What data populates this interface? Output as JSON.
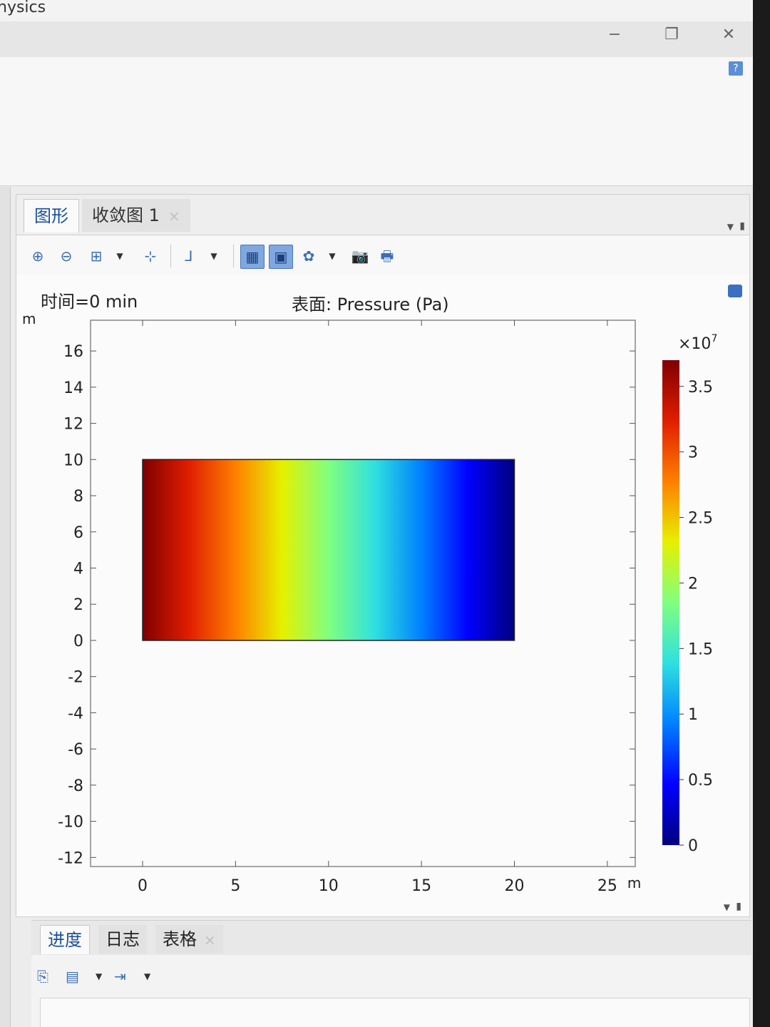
{
  "window": {
    "title": "hysics",
    "minimize": "−",
    "restore": "❐",
    "close": "✕",
    "help": "?"
  },
  "graphics_panel": {
    "tabs": [
      {
        "label": "图形",
        "active": true
      },
      {
        "label": "收敛图 1",
        "close": "×"
      }
    ],
    "panel_menu": "▼",
    "pin": "▮",
    "toolbar": {
      "zoom_in": "⊕",
      "zoom_out": "⊖",
      "zoom_box": "⊞",
      "dropdown": "▼",
      "zoom_extents": "⊹",
      "axis_orientation": "⅃",
      "grid_toggle": "▦",
      "legend_toggle": "▣",
      "scene_light": "✿",
      "snapshot": "📷",
      "print": "🖶"
    },
    "time_label": "时间=0 min",
    "plot_title": "表面: Pressure (Pa)",
    "y_unit": "m",
    "x_unit": "m"
  },
  "chart_data": {
    "type": "heatmap",
    "title": "表面: Pressure (Pa)",
    "subtitle": "时间=0 min",
    "x_ticks": [
      0,
      5,
      10,
      15,
      20,
      25
    ],
    "y_ticks": [
      -12,
      -10,
      -8,
      -6,
      -4,
      -2,
      0,
      2,
      4,
      6,
      8,
      10,
      12,
      14,
      16
    ],
    "x_unit": "m",
    "y_unit": "m",
    "xlim": [
      -2.8,
      26.5
    ],
    "ylim": [
      -12.5,
      17.7
    ],
    "domain": {
      "x": [
        0,
        20
      ],
      "y": [
        0,
        10
      ]
    },
    "field": "pressure decreasing linearly in x from max at x=0 to min at x=20",
    "colorbar": {
      "multiplier": "×10",
      "exponent": "7",
      "ticks": [
        0,
        0.5,
        1,
        1.5,
        2,
        2.5,
        3,
        3.5
      ],
      "tick_labels": [
        "0",
        "0.5",
        "1",
        "1.5",
        "2",
        "2.5",
        "3",
        "3.5"
      ],
      "range": [
        0,
        3.7
      ],
      "colormap": [
        "#00007f",
        "#0000ff",
        "#0080ff",
        "#2fe0e0",
        "#80ff80",
        "#e6f000",
        "#ff8000",
        "#e01e00",
        "#7f0000"
      ]
    }
  },
  "bottom_panel": {
    "tabs": [
      {
        "label": "进度",
        "active": true
      },
      {
        "label": "日志"
      },
      {
        "label": "表格",
        "close": "×"
      }
    ],
    "panel_menu": "▼",
    "pin": "▮",
    "toolbar": {
      "clear": "⎘",
      "display": "▤",
      "dropdown": "▼",
      "step": "⇥"
    }
  }
}
